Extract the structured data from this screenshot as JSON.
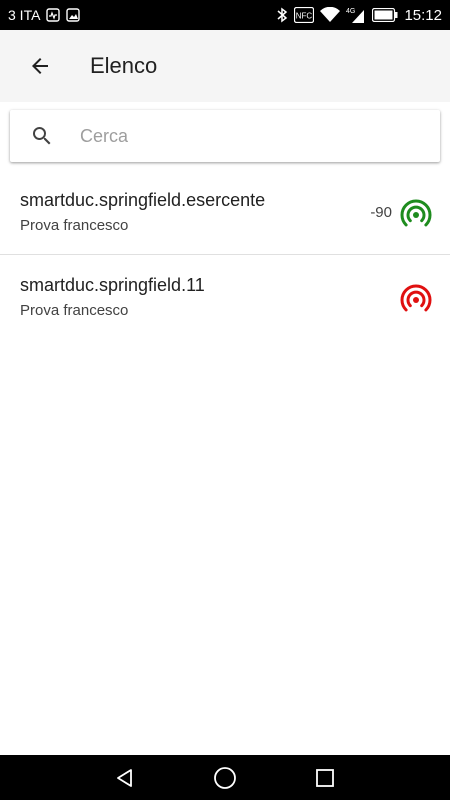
{
  "status_bar": {
    "carrier": "3 ITA",
    "nfc_label": "NFC",
    "network_type": "4G",
    "time": "15:12"
  },
  "app_bar": {
    "title": "Elenco"
  },
  "search": {
    "placeholder": "Cerca",
    "value": ""
  },
  "devices": [
    {
      "name": "smartduc.springfield.esercente",
      "subtitle": "Prova francesco",
      "rssi": "-90",
      "signal_icon": "broadcast-icon",
      "signal_color": "#1e8c1e"
    },
    {
      "name": "smartduc.springfield.11",
      "subtitle": "Prova francesco",
      "rssi": "",
      "signal_icon": "broadcast-icon",
      "signal_color": "#e01010"
    }
  ],
  "colors": {
    "app_bar_bg": "#f5f5f5",
    "status_bar_bg": "#000000",
    "nav_bar_bg": "#000000"
  }
}
